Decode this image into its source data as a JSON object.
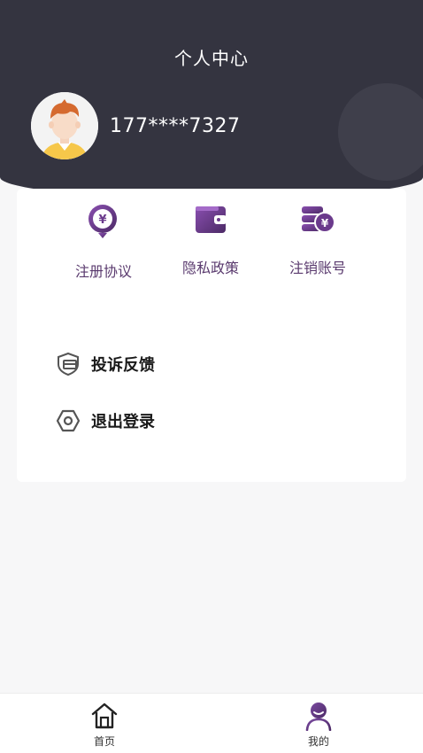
{
  "header": {
    "title": "个人中心",
    "phone": "177****7327"
  },
  "quick_actions": [
    {
      "label": "注册协议",
      "icon": "agreement-coin-icon"
    },
    {
      "label": "隐私政策",
      "icon": "wallet-icon"
    },
    {
      "label": "注销账号",
      "icon": "coin-stack-icon"
    }
  ],
  "menu": [
    {
      "label": "投诉反馈",
      "icon": "shield-card-icon"
    },
    {
      "label": "退出登录",
      "icon": "hexagon-nut-icon"
    }
  ],
  "tabbar": [
    {
      "label": "首页",
      "icon": "home-icon"
    },
    {
      "label": "我的",
      "icon": "user-icon",
      "active": true
    }
  ],
  "colors": {
    "header_bg": "#343440",
    "accent_purple": "#6b3a8c",
    "page_bg": "#f7f7f8"
  }
}
